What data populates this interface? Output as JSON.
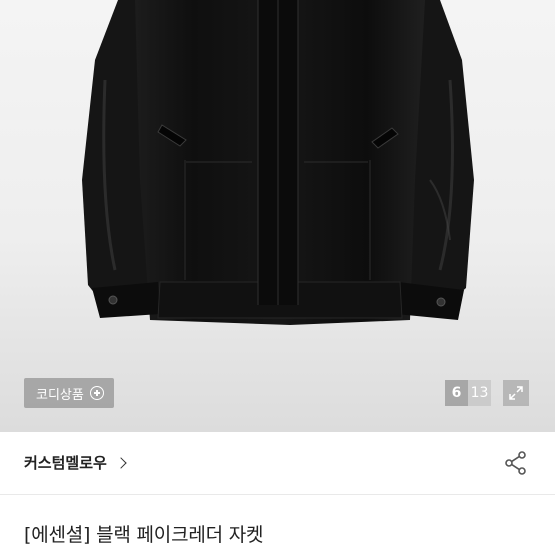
{
  "gallery": {
    "coordi_label": "코디상품",
    "current_page": "6",
    "total_pages": "13"
  },
  "product": {
    "brand": "커스텀멜로우",
    "title": "[에센셜] 블랙 페이크레더 자켓"
  },
  "icons": {
    "plus": "plus-circle-icon",
    "expand": "expand-icon",
    "share": "share-icon",
    "chevron": "chevron-right-icon"
  },
  "colors": {
    "text": "#222222",
    "overlay": "#787878"
  }
}
